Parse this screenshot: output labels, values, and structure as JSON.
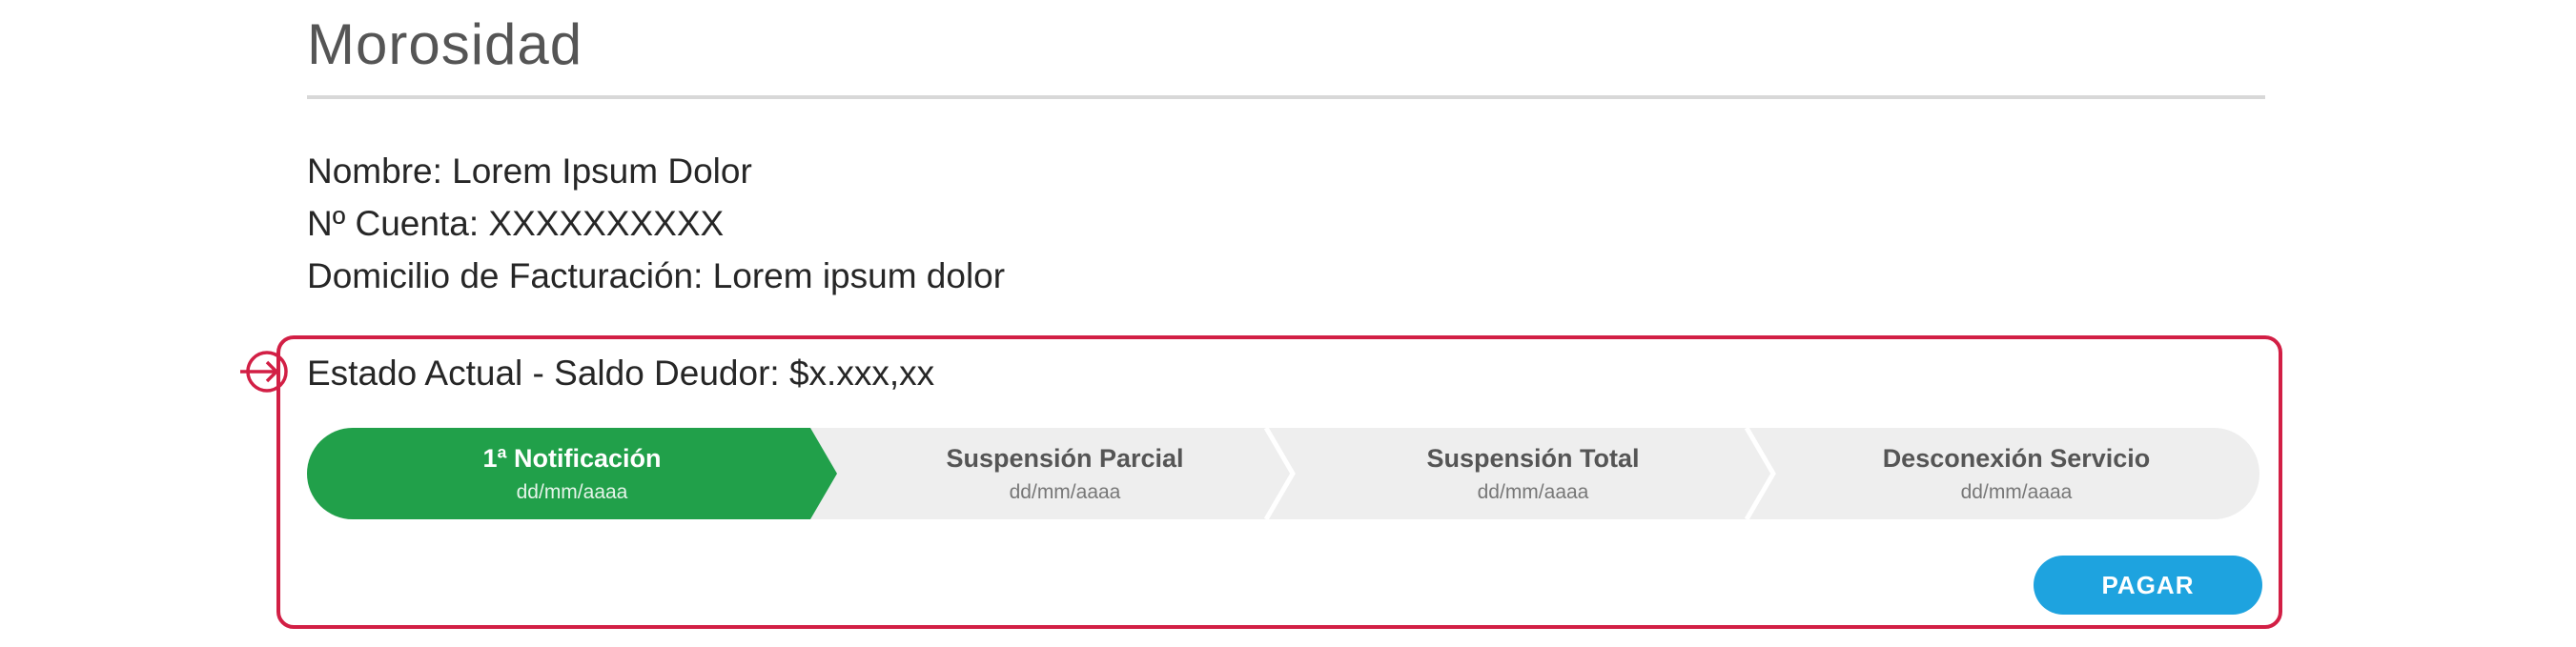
{
  "page": {
    "title": "Morosidad"
  },
  "account": {
    "name_line": "Nombre: Lorem Ipsum Dolor",
    "account_line": "Nº Cuenta: XXXXXXXXXX",
    "address_line": "Domicilio de Facturación: Lorem ipsum dolor"
  },
  "status": {
    "heading": "Estado Actual - Saldo Deudor: $x.xxx,xx",
    "marker_icon": "arrow-right-circle-icon",
    "steps": [
      {
        "label": "1ª Notificación",
        "date": "dd/mm/aaaa",
        "state": "active"
      },
      {
        "label": "Suspensión Parcial",
        "date": "dd/mm/aaaa",
        "state": "pending"
      },
      {
        "label": "Suspensión Total",
        "date": "dd/mm/aaaa",
        "state": "pending"
      },
      {
        "label": "Desconexión Servicio",
        "date": "dd/mm/aaaa",
        "state": "pending"
      }
    ],
    "pay_label": "PAGAR"
  },
  "colors": {
    "active_step": "#21a04a",
    "pending_step": "#eeeeee",
    "highlight_border": "#d21f45",
    "pay_button": "#1ea3df"
  }
}
